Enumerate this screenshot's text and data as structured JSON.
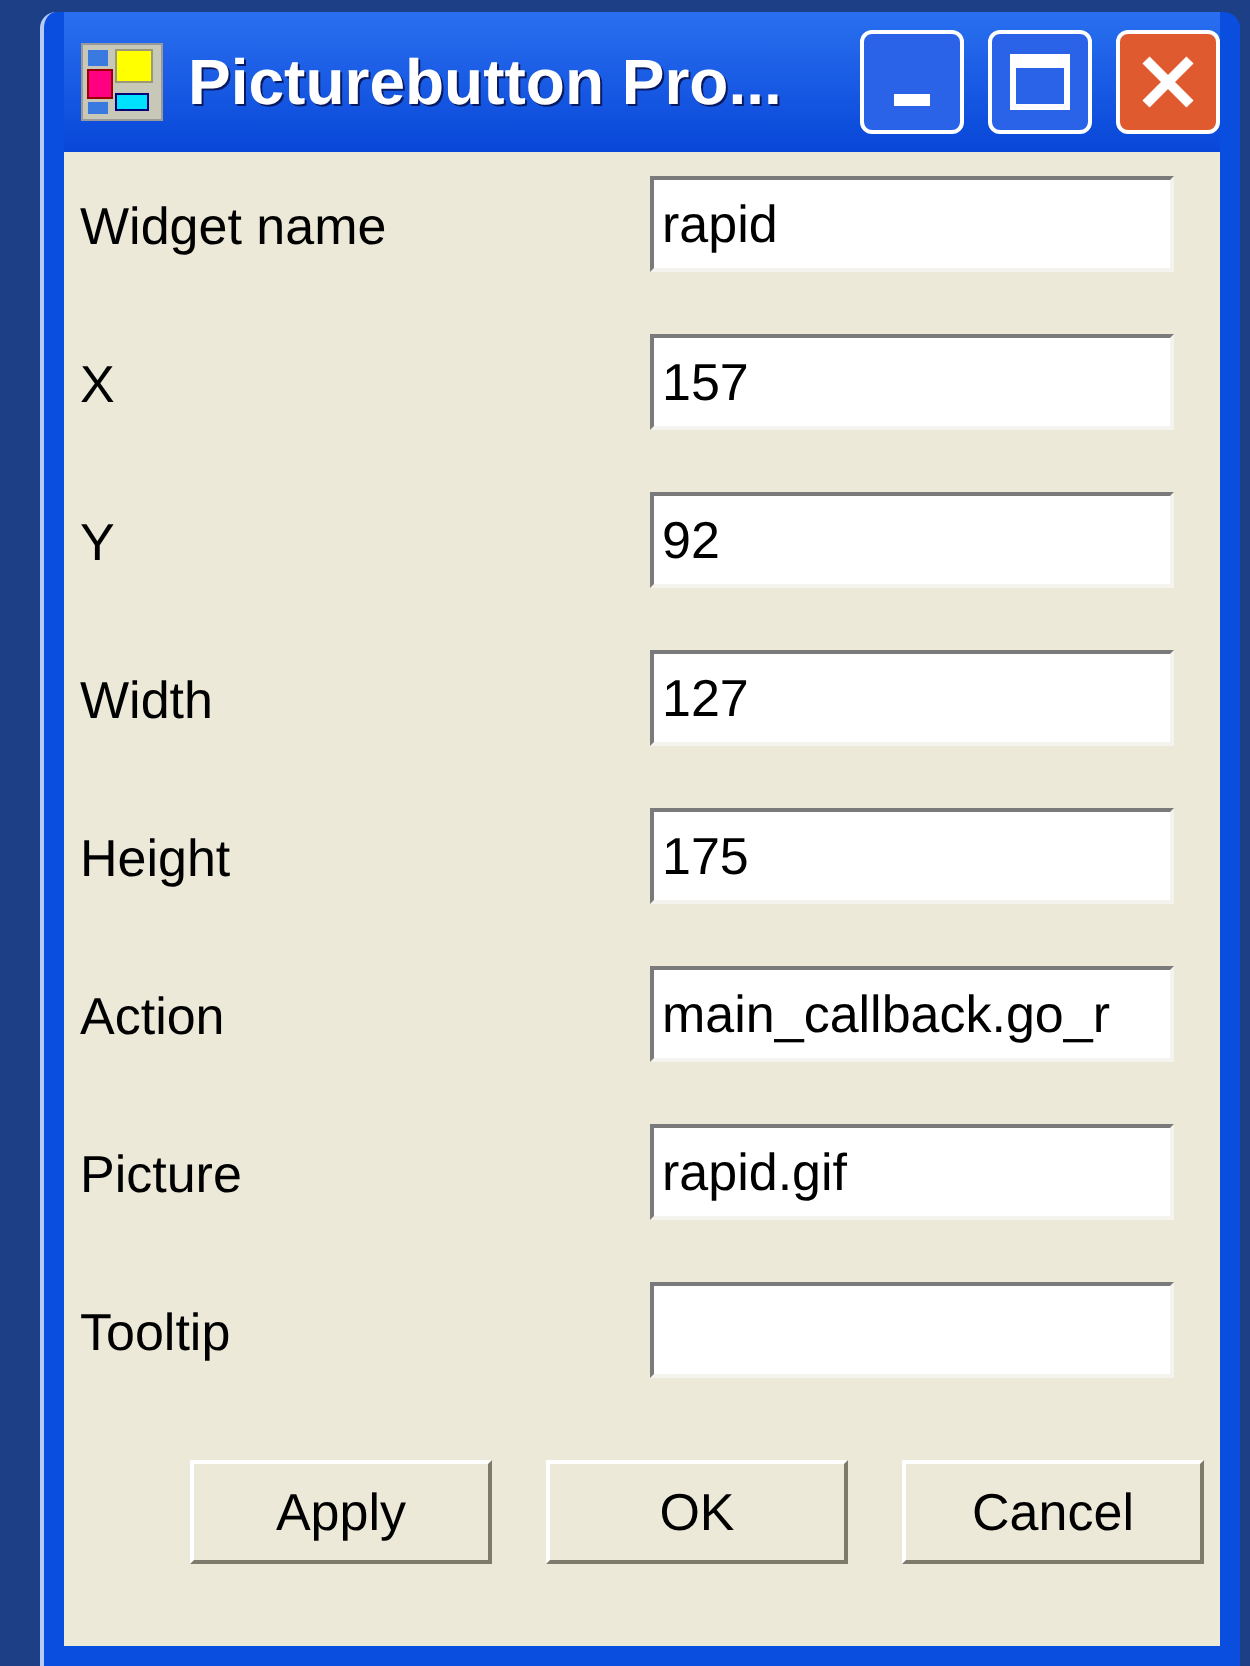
{
  "window": {
    "title": "Picturebutton Pro..."
  },
  "fields": [
    {
      "label": "Widget name",
      "value": "rapid"
    },
    {
      "label": "X",
      "value": "157"
    },
    {
      "label": "Y",
      "value": "92"
    },
    {
      "label": "Width",
      "value": "127"
    },
    {
      "label": "Height",
      "value": "175"
    },
    {
      "label": "Action",
      "value": "main_callback.go_r"
    },
    {
      "label": "Picture",
      "value": "rapid.gif"
    },
    {
      "label": "Tooltip"
    }
  ],
  "buttons": [
    "Apply",
    "OK",
    "Cancel"
  ]
}
